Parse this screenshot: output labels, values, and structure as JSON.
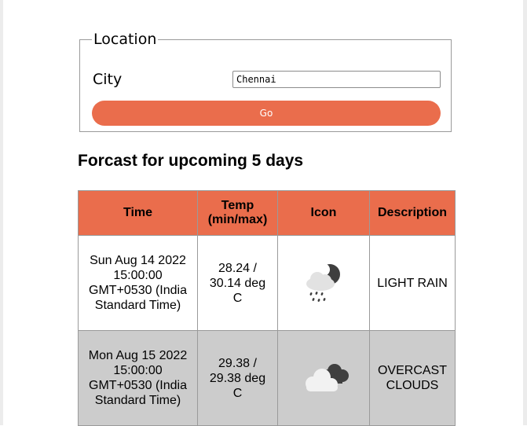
{
  "location": {
    "legend": "Location",
    "city_label": "City",
    "city_value": "Chennai",
    "go_label": "Go"
  },
  "forecast": {
    "title": "Forcast for upcoming 5 days",
    "headers": {
      "time": "Time",
      "temp_line1": "Temp",
      "temp_line2": "(min/max)",
      "icon": "Icon",
      "description": "Description"
    },
    "rows": [
      {
        "time_lines": [
          "Sun Aug 14 2022",
          "15:00:00",
          "GMT+0530 (India",
          "Standard Time)"
        ],
        "temp_lines": [
          "28.24 /",
          "30.14 deg",
          "C"
        ],
        "icon": "cloud-rain-night-icon",
        "description": "LIGHT RAIN"
      },
      {
        "time_lines": [
          "Mon Aug 15 2022",
          "15:00:00",
          "GMT+0530 (India",
          "Standard Time)"
        ],
        "temp_lines": [
          "29.38 /",
          "29.38 deg",
          "C"
        ],
        "icon": "overcast-clouds-icon",
        "description_lines": [
          "OVERCAST",
          "CLOUDS"
        ]
      }
    ]
  },
  "colors": {
    "accent": "#ea6d4c",
    "row_alt": "#cccccc"
  }
}
